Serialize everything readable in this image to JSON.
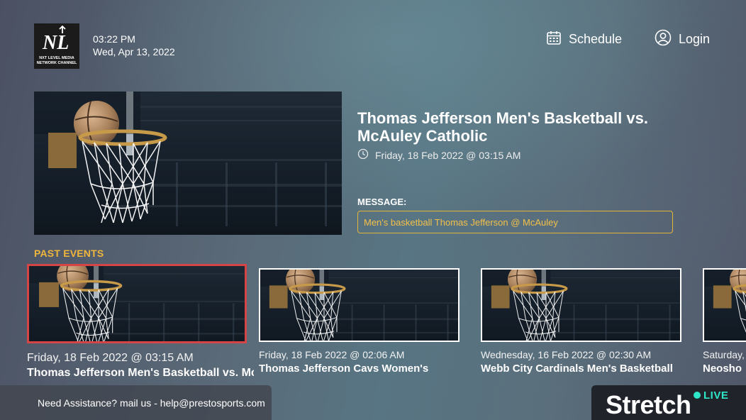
{
  "header": {
    "logo_text": "NL",
    "logo_caption_1": "NXT LEVEL MEDIA",
    "logo_caption_2": "NETWORK CHANNEL",
    "time": "03:22 PM",
    "date": "Wed, Apr 13, 2022",
    "nav": {
      "schedule_label": "Schedule",
      "schedule_icon": "calendar-icon",
      "login_label": "Login",
      "login_icon": "user-circle-icon"
    }
  },
  "featured": {
    "title": "Thomas Jefferson Men's Basketball vs. McAuley Catholic",
    "datetime": "Friday, 18 Feb 2022 @ 03:15 AM",
    "clock_icon": "clock-icon",
    "message_label": "MESSAGE:",
    "message": "Men's basketball Thomas Jefferson @ McAuley"
  },
  "past_events": {
    "title": "PAST EVENTS",
    "items": [
      {
        "date": "Friday, 18 Feb 2022 @ 03:15 AM",
        "title": "Thomas Jefferson Men's Basketball vs. McAuley Catholic"
      },
      {
        "date": "Friday, 18 Feb 2022 @ 02:06 AM",
        "title": "Thomas Jefferson Cavs Women's"
      },
      {
        "date": "Wednesday, 16 Feb 2022 @ 02:30 AM",
        "title": "Webb City Cardinals Men's Basketball"
      },
      {
        "date": "Saturday,",
        "title": "Neosho"
      }
    ]
  },
  "footer": {
    "help_text": "Need Assistance? mail us - help@prestosports.com",
    "brand_name": "Stretch",
    "brand_badge": "LIVE"
  },
  "colors": {
    "accent": "#f0b63c",
    "focus_border": "#d64545",
    "brand_live": "#2ee6c8"
  }
}
